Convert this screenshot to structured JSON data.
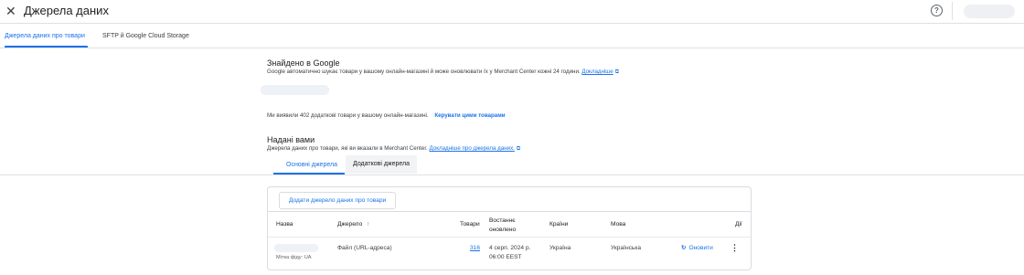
{
  "header": {
    "title": "Джерела даних",
    "close_icon": "close-icon",
    "help_icon": "help-icon"
  },
  "tabs": [
    {
      "label": "Джерела даних про товари",
      "active": true
    },
    {
      "label": "SFTP й Google Cloud Storage",
      "active": false
    }
  ],
  "google_section": {
    "heading": "Знайдено в Google",
    "text": "Google автоматично шукає товари у вашому онлайн-магазині й може оновлювати їх у Merchant Center кожні 24 години.",
    "link": "Докладніше",
    "found_text": "Ми виявили 402 додаткові товари у вашому онлайн-магазині.",
    "manage_link": "Керувати цими товарами"
  },
  "provided_section": {
    "heading": "Надані вами",
    "text": "Джерела даних про товари, які ви вказали в Merchant Center.",
    "link": "Докладніше про джерела даних."
  },
  "subtabs": [
    {
      "label": "Основні джерела",
      "active": true
    },
    {
      "label": "Додаткові джерела",
      "active": false
    }
  ],
  "table": {
    "add_button": "Додати джерело даних про товари",
    "columns": {
      "name": "Назва",
      "source": "Джерело",
      "sort_arrow": "↑",
      "products": "Товари",
      "last_updated": "Востаннє оновлено",
      "countries": "Країни",
      "language": "Мова",
      "actions": "Дії"
    },
    "rows": [
      {
        "feed_label": "Мітка фіду: UA",
        "source": "Файл (URL-адреса)",
        "products": "316",
        "updated_date": "4 серп. 2024 р.",
        "updated_time": "06:00 EEST",
        "country": "Україна",
        "language": "Українська",
        "action": "Оновити"
      }
    ]
  },
  "colors": {
    "accent": "#1a73e8",
    "border": "#dadce0",
    "tab_bg": "#f1f3f4"
  }
}
